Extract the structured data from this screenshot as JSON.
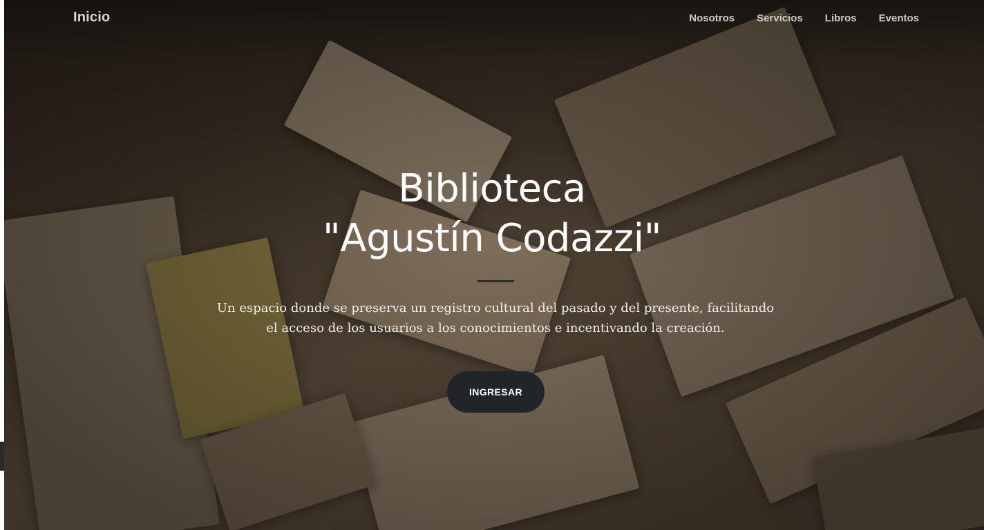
{
  "navbar": {
    "brand": "Inicio",
    "links": [
      {
        "label": "Nosotros"
      },
      {
        "label": "Servicios"
      },
      {
        "label": "Libros"
      },
      {
        "label": "Eventos"
      }
    ]
  },
  "hero": {
    "title_line1": "Biblioteca",
    "title_line2": "\"Agustín Codazzi\"",
    "subtitle": "Un espacio donde se preserva un registro cultural del pasado y del presente, facilitando el acceso de los usuarios a los conocimientos e incentivando la creación.",
    "cta_label": "INGRESAR"
  },
  "colors": {
    "button_bg": "#212429",
    "nav_text": "#cfcac4",
    "title_text": "#ffffff",
    "divider": "#2d2a26"
  }
}
